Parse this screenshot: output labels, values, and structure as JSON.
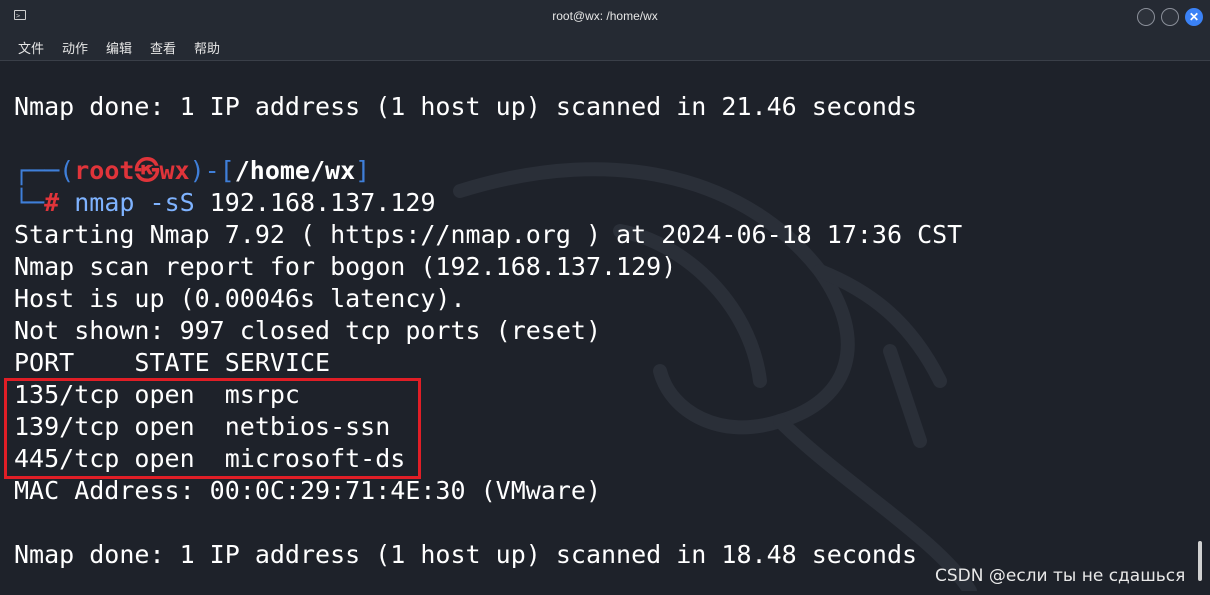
{
  "window": {
    "title": "root@wx: /home/wx",
    "close_glyph": "✕"
  },
  "menu": {
    "items": [
      "文件",
      "动作",
      "编辑",
      "查看",
      "帮助"
    ]
  },
  "terminal": {
    "line1": "Nmap done: 1 IP address (1 host up) scanned in 21.46 seconds",
    "prompt": {
      "corner_top": "┌──(",
      "user": "root",
      "at_symbol": "㉿",
      "host": "wx",
      "mid": ")-[",
      "path": "/home/wx",
      "end": "]",
      "corner_bottom": "└─",
      "hash": "#",
      "command": "nmap",
      "flag": "-sS",
      "target": "192.168.137.129"
    },
    "output": [
      "Starting Nmap 7.92 ( https://nmap.org ) at 2024-06-18 17:36 CST",
      "Nmap scan report for bogon (192.168.137.129)",
      "Host is up (0.00046s latency).",
      "Not shown: 997 closed tcp ports (reset)",
      "PORT    STATE SERVICE",
      "135/tcp open  msrpc",
      "139/tcp open  netbios-ssn",
      "445/tcp open  microsoft-ds",
      "MAC Address: 00:0C:29:71:4E:30 (VMware)",
      "",
      "Nmap done: 1 IP address (1 host up) scanned in 18.48 seconds"
    ]
  },
  "watermark": "CSDN @если ты не сдашься",
  "colors": {
    "background": "#1e222a",
    "prompt_blue": "#3f7fd9",
    "prompt_red": "#e0343a",
    "highlight": "#e01e26"
  }
}
